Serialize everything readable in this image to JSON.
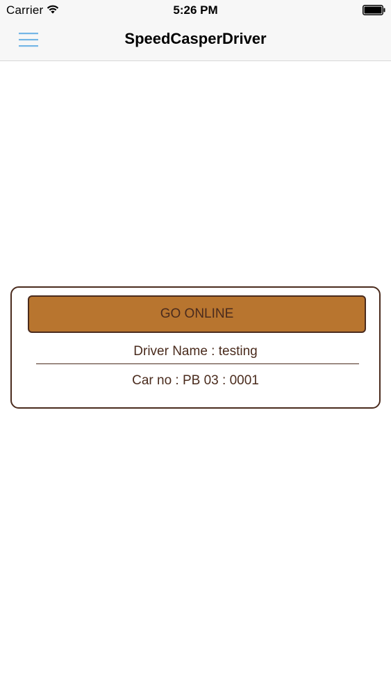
{
  "status_bar": {
    "carrier": "Carrier",
    "time": "5:26 PM",
    "wifi_icon": "wifi-icon",
    "battery_icon": "battery-icon"
  },
  "nav": {
    "title": "SpeedCasperDriver",
    "menu_icon": "hamburger-menu-icon",
    "menu_icon_color": "#74b6e6"
  },
  "card": {
    "go_online_label": "GO ONLINE",
    "driver_name": "Driver Name : testing",
    "car_no": "Car no : PB 03 : 0001",
    "accent_color": "#b8752f",
    "border_color": "#4a2b1d"
  }
}
